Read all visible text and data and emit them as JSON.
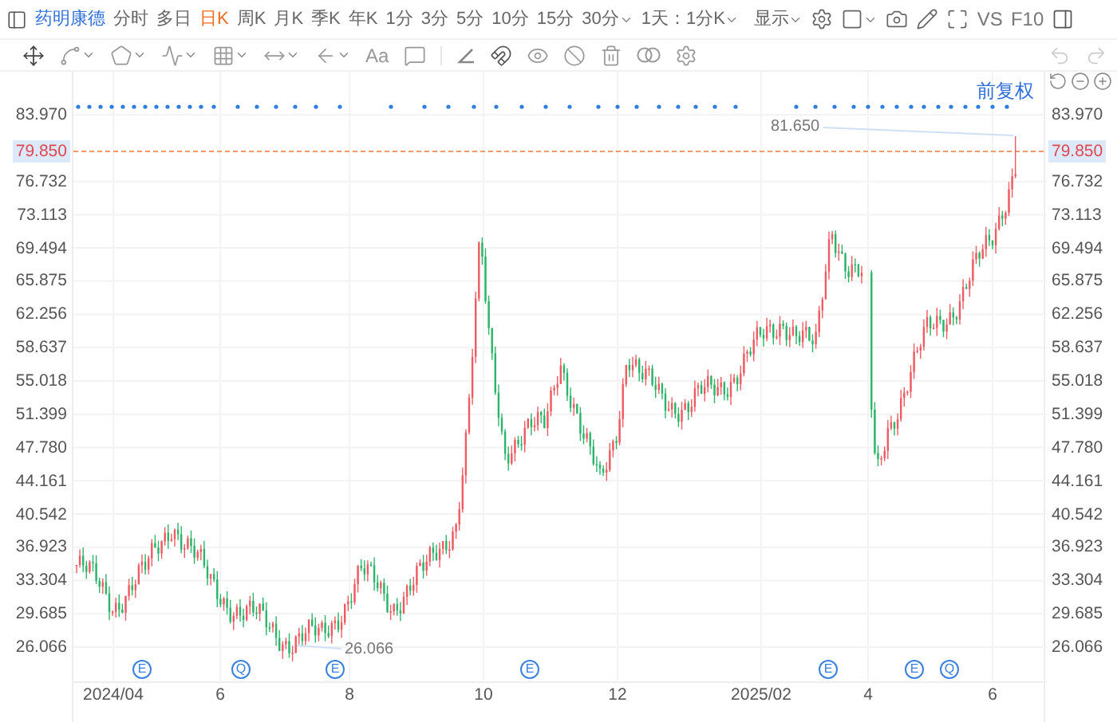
{
  "toolbar": {
    "stock_name": "药明康德",
    "periods": [
      {
        "label": "分时",
        "selected": false,
        "dropdown": false
      },
      {
        "label": "多日",
        "selected": false,
        "dropdown": false
      },
      {
        "label": "日K",
        "selected": true,
        "dropdown": false
      },
      {
        "label": "周K",
        "selected": false,
        "dropdown": false
      },
      {
        "label": "月K",
        "selected": false,
        "dropdown": false
      },
      {
        "label": "季K",
        "selected": false,
        "dropdown": false
      },
      {
        "label": "年K",
        "selected": false,
        "dropdown": false
      },
      {
        "label": "1分",
        "selected": false,
        "dropdown": false
      },
      {
        "label": "3分",
        "selected": false,
        "dropdown": false
      },
      {
        "label": "5分",
        "selected": false,
        "dropdown": false
      },
      {
        "label": "10分",
        "selected": false,
        "dropdown": false
      },
      {
        "label": "15分",
        "selected": false,
        "dropdown": false
      },
      {
        "label": "30分",
        "selected": false,
        "dropdown": true
      }
    ],
    "range": "1天：1分K",
    "display": "显示",
    "compare": "VS",
    "f10": "F10"
  },
  "drawing_tools": {
    "text_tool": "Aa"
  },
  "chart": {
    "adjust_mode": "前复权",
    "y_axis_left": [
      {
        "label": "83.970",
        "current": false
      },
      {
        "label": "79.850",
        "current": true
      },
      {
        "label": "76.732",
        "current": false
      },
      {
        "label": "73.113",
        "current": false
      },
      {
        "label": "69.494",
        "current": false
      },
      {
        "label": "65.875",
        "current": false
      },
      {
        "label": "62.256",
        "current": false
      },
      {
        "label": "58.637",
        "current": false
      },
      {
        "label": "55.018",
        "current": false
      },
      {
        "label": "51.399",
        "current": false
      },
      {
        "label": "47.780",
        "current": false
      },
      {
        "label": "44.161",
        "current": false
      },
      {
        "label": "40.542",
        "current": false
      },
      {
        "label": "36.923",
        "current": false
      },
      {
        "label": "33.304",
        "current": false
      },
      {
        "label": "29.685",
        "current": false
      },
      {
        "label": "26.066",
        "current": false
      }
    ],
    "y_axis_right": [
      {
        "label": "83.970",
        "current": false
      },
      {
        "label": "79.850",
        "current": true
      },
      {
        "label": "76.732",
        "current": false
      },
      {
        "label": "73.113",
        "current": false
      },
      {
        "label": "69.494",
        "current": false
      },
      {
        "label": "65.875",
        "current": false
      },
      {
        "label": "62.256",
        "current": false
      },
      {
        "label": "58.637",
        "current": false
      },
      {
        "label": "55.018",
        "current": false
      },
      {
        "label": "51.399",
        "current": false
      },
      {
        "label": "47.780",
        "current": false
      },
      {
        "label": "44.161",
        "current": false
      },
      {
        "label": "40.542",
        "current": false
      },
      {
        "label": "36.923",
        "current": false
      },
      {
        "label": "33.304",
        "current": false
      },
      {
        "label": "29.685",
        "current": false
      },
      {
        "label": "26.066",
        "current": false
      }
    ],
    "x_axis": [
      "2024/04",
      "6",
      "8",
      "10",
      "12",
      "2025/02",
      "4",
      "6"
    ],
    "markers": [
      {
        "letter": "E"
      },
      {
        "letter": "Q"
      },
      {
        "letter": "E"
      },
      {
        "letter": "E"
      },
      {
        "letter": "E"
      },
      {
        "letter": "E"
      },
      {
        "letter": "Q"
      }
    ],
    "high_label": "81.650",
    "low_label": "26.066"
  }
}
